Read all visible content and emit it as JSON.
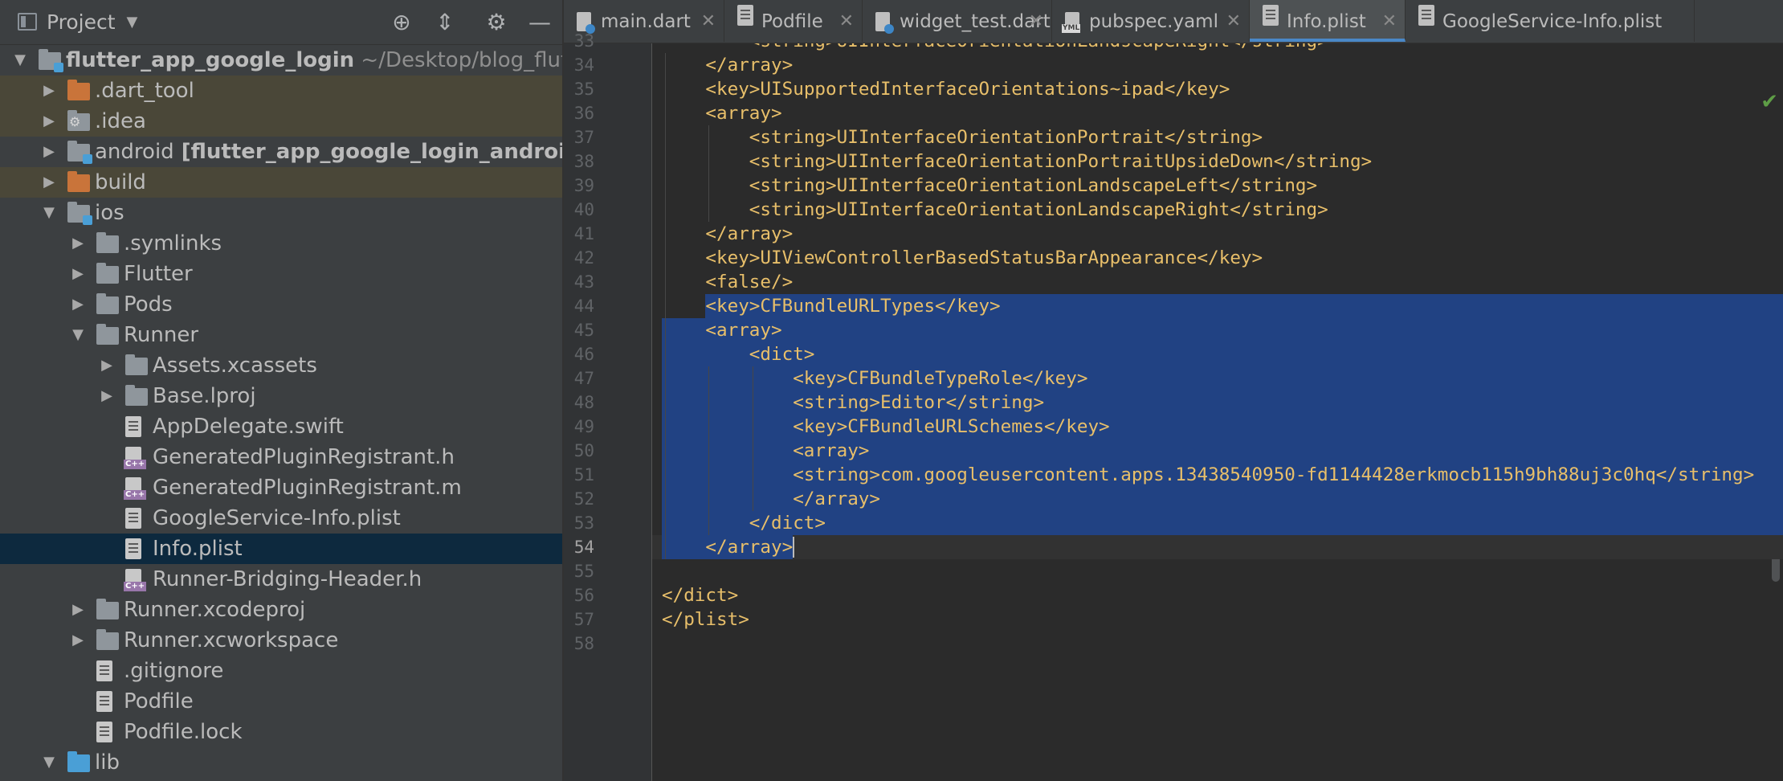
{
  "project_panel": {
    "title": "Project",
    "tree": [
      {
        "label": "flutter_app_google_login",
        "extra": " ~/Desktop/blog_flut",
        "bold": true,
        "indent": 0,
        "arrow": "▼",
        "icon": "folder module"
      },
      {
        "label": ".dart_tool",
        "indent": 1,
        "arrow": "▶",
        "icon": "folder orange",
        "excluded": true
      },
      {
        "label": ".idea",
        "indent": 1,
        "arrow": "▶",
        "icon": "folder gear",
        "excluded": true
      },
      {
        "label": "android",
        "extra": " [flutter_app_google_login_android]",
        "extra_bold": true,
        "indent": 1,
        "arrow": "▶",
        "icon": "folder module"
      },
      {
        "label": "build",
        "indent": 1,
        "arrow": "▶",
        "icon": "folder orange",
        "excluded": true
      },
      {
        "label": "ios",
        "indent": 1,
        "arrow": "▼",
        "icon": "folder module"
      },
      {
        "label": ".symlinks",
        "indent": 2,
        "arrow": "▶",
        "icon": "folder"
      },
      {
        "label": "Flutter",
        "indent": 2,
        "arrow": "▶",
        "icon": "folder"
      },
      {
        "label": "Pods",
        "indent": 2,
        "arrow": "▶",
        "icon": "folder"
      },
      {
        "label": "Runner",
        "indent": 2,
        "arrow": "▼",
        "icon": "folder"
      },
      {
        "label": "Assets.xcassets",
        "indent": 3,
        "arrow": "▶",
        "icon": "folder"
      },
      {
        "label": "Base.lproj",
        "indent": 3,
        "arrow": "▶",
        "icon": "folder"
      },
      {
        "label": "AppDelegate.swift",
        "indent": 3,
        "arrow": "",
        "icon": "file"
      },
      {
        "label": "GeneratedPluginRegistrant.h",
        "indent": 3,
        "arrow": "",
        "icon": "file-c"
      },
      {
        "label": "GeneratedPluginRegistrant.m",
        "indent": 3,
        "arrow": "",
        "icon": "file-c"
      },
      {
        "label": "GoogleService-Info.plist",
        "indent": 3,
        "arrow": "",
        "icon": "file"
      },
      {
        "label": "Info.plist",
        "indent": 3,
        "arrow": "",
        "icon": "file",
        "selected": true
      },
      {
        "label": "Runner-Bridging-Header.h",
        "indent": 3,
        "arrow": "",
        "icon": "file-c"
      },
      {
        "label": "Runner.xcodeproj",
        "indent": 2,
        "arrow": "▶",
        "icon": "folder"
      },
      {
        "label": "Runner.xcworkspace",
        "indent": 2,
        "arrow": "▶",
        "icon": "folder"
      },
      {
        "label": ".gitignore",
        "indent": 2,
        "arrow": "",
        "icon": "file"
      },
      {
        "label": "Podfile",
        "indent": 2,
        "arrow": "",
        "icon": "file"
      },
      {
        "label": "Podfile.lock",
        "indent": 2,
        "arrow": "",
        "icon": "file"
      },
      {
        "label": "lib",
        "indent": 1,
        "arrow": "▼",
        "icon": "folder blue"
      }
    ]
  },
  "tabs": [
    {
      "label": "main.dart",
      "icon": "dart",
      "active": false
    },
    {
      "label": "Podfile",
      "icon": "file",
      "active": false
    },
    {
      "label": "widget_test.dart",
      "icon": "dart",
      "active": false
    },
    {
      "label": "pubspec.yaml",
      "icon": "yml",
      "active": false
    },
    {
      "label": "Info.plist",
      "icon": "file",
      "active": true
    },
    {
      "label": "GoogleService-Info.plist",
      "icon": "file",
      "active": false,
      "no_close": true
    }
  ],
  "editor": {
    "current_line": 54,
    "lines": [
      {
        "n": 33,
        "indent": 2,
        "text": "<string>UIInterfaceOrientationLandscapeRight</string>"
      },
      {
        "n": 34,
        "indent": 1,
        "text": "</array>"
      },
      {
        "n": 35,
        "indent": 1,
        "text": "<key>UISupportedInterfaceOrientations~ipad</key>"
      },
      {
        "n": 36,
        "indent": 1,
        "text": "<array>"
      },
      {
        "n": 37,
        "indent": 2,
        "text": "<string>UIInterfaceOrientationPortrait</string>"
      },
      {
        "n": 38,
        "indent": 2,
        "text": "<string>UIInterfaceOrientationPortraitUpsideDown</string>"
      },
      {
        "n": 39,
        "indent": 2,
        "text": "<string>UIInterfaceOrientationLandscapeLeft</string>"
      },
      {
        "n": 40,
        "indent": 2,
        "text": "<string>UIInterfaceOrientationLandscapeRight</string>"
      },
      {
        "n": 41,
        "indent": 1,
        "text": "</array>"
      },
      {
        "n": 42,
        "indent": 1,
        "text": "<key>UIViewControllerBasedStatusBarAppearance</key>"
      },
      {
        "n": 43,
        "indent": 1,
        "text": "<false/>"
      },
      {
        "n": 44,
        "indent": 1,
        "text": "<key>CFBundleURLTypes</key>"
      },
      {
        "n": 45,
        "indent": 1,
        "text": "<array>"
      },
      {
        "n": 46,
        "indent": 2,
        "text": "<dict>"
      },
      {
        "n": 47,
        "indent": 3,
        "text": "<key>CFBundleTypeRole</key>"
      },
      {
        "n": 48,
        "indent": 3,
        "text": "<string>Editor</string>"
      },
      {
        "n": 49,
        "indent": 3,
        "text": "<key>CFBundleURLSchemes</key>"
      },
      {
        "n": 50,
        "indent": 3,
        "text": "<array>"
      },
      {
        "n": 51,
        "indent": 3,
        "text": "<string>com.googleusercontent.apps.13438540950-fd1144428erkmocb115h9bh88uj3c0hq</string>"
      },
      {
        "n": 52,
        "indent": 3,
        "text": "</array>"
      },
      {
        "n": 53,
        "indent": 2,
        "text": "</dict>"
      },
      {
        "n": 54,
        "indent": 1,
        "text": "</array>"
      },
      {
        "n": 55,
        "indent": 0,
        "text": ""
      },
      {
        "n": 56,
        "indent": 0,
        "text": "</dict>"
      },
      {
        "n": 57,
        "indent": 0,
        "text": "</plist>"
      },
      {
        "n": 58,
        "indent": 0,
        "text": ""
      }
    ]
  },
  "colors": {
    "panel_bg": "#3c3f41",
    "editor_bg": "#2b2b2b",
    "selection": "#214283",
    "tree_selection": "#0d293e",
    "excluded_bg": "#4a4738",
    "tag_color": "#e8bf6a",
    "accent": "#4a88c7"
  }
}
